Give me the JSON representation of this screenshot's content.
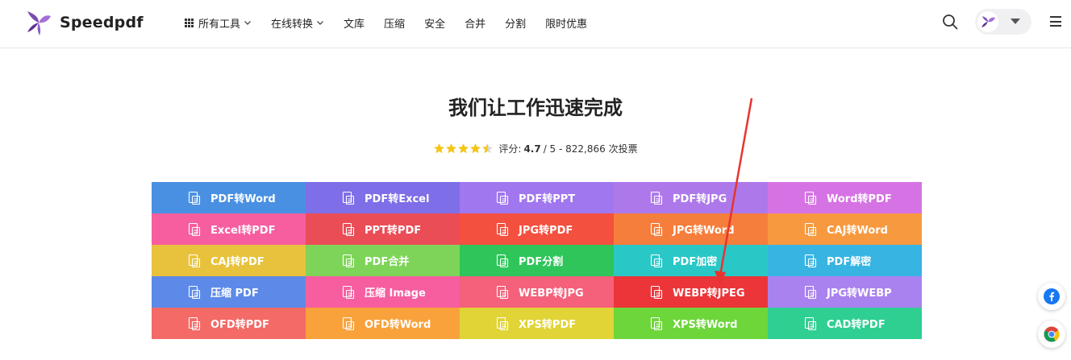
{
  "header": {
    "brand": "Speedpdf",
    "nav": [
      {
        "label": "所有工具",
        "icon": "grid-icon",
        "dropdown": true
      },
      {
        "label": "在线转换",
        "dropdown": true
      },
      {
        "label": "文库"
      },
      {
        "label": "压缩"
      },
      {
        "label": "安全"
      },
      {
        "label": "合并"
      },
      {
        "label": "分割"
      },
      {
        "label": "限时优惠"
      }
    ],
    "icons": [
      "search-icon",
      "avatar",
      "caret-down-icon",
      "menu-icon"
    ]
  },
  "hero": {
    "title": "我们让工作迅速完成",
    "rating": {
      "prefix": "评分:",
      "score": "4.7",
      "rest": "/ 5 - 822,866 次投票",
      "stars": 4.5
    }
  },
  "tools": [
    {
      "label": "PDF转Word",
      "color": "#4a90e2"
    },
    {
      "label": "PDF转Excel",
      "color": "#7e6ee7"
    },
    {
      "label": "PDF转PPT",
      "color": "#a077ef"
    },
    {
      "label": "PDF转JPG",
      "color": "#ad79ea"
    },
    {
      "label": "Word转PDF",
      "color": "#d673e4"
    },
    {
      "label": "Excel转PDF",
      "color": "#f65ea0"
    },
    {
      "label": "PPT转PDF",
      "color": "#ea4d56"
    },
    {
      "label": "JPG转PDF",
      "color": "#f4503f"
    },
    {
      "label": "JPG转Word",
      "color": "#f67e3c"
    },
    {
      "label": "CAJ转Word",
      "color": "#f7993f"
    },
    {
      "label": "CAJ转PDF",
      "color": "#e8c23c"
    },
    {
      "label": "PDF合并",
      "color": "#7ed458"
    },
    {
      "label": "PDF分割",
      "color": "#2fc55a"
    },
    {
      "label": "PDF加密",
      "color": "#2ac7c7"
    },
    {
      "label": "PDF解密",
      "color": "#37b4e1"
    },
    {
      "label": "压缩 PDF",
      "color": "#5d8ae8"
    },
    {
      "label": "压缩 Image",
      "color": "#f65ea0"
    },
    {
      "label": "WEBP转JPG",
      "color": "#f5607a"
    },
    {
      "label": "WEBP转JPEG",
      "color": "#ec3538"
    },
    {
      "label": "JPG转WEBP",
      "color": "#a982ef"
    },
    {
      "label": "OFD转PDF",
      "color": "#f46a67"
    },
    {
      "label": "OFD转Word",
      "color": "#f9a23c"
    },
    {
      "label": "XPS转PDF",
      "color": "#e0d437"
    },
    {
      "label": "XPS转Word",
      "color": "#6dd63a"
    },
    {
      "label": "CAD转PDF",
      "color": "#2fcf92"
    }
  ],
  "floating": [
    "facebook-icon",
    "chrome-icon"
  ]
}
